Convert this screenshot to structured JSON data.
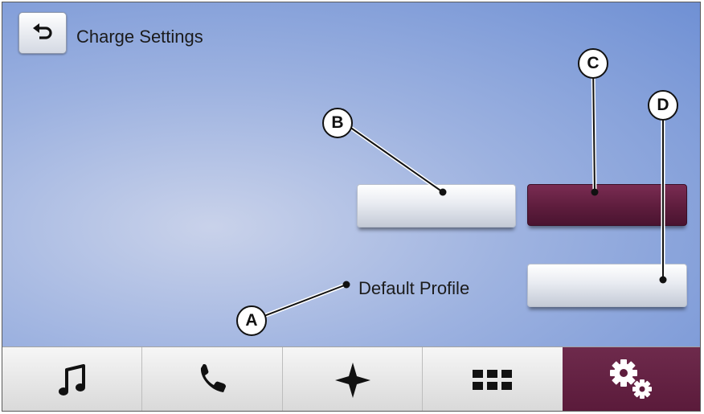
{
  "header": {
    "title": "Charge Settings",
    "back_icon": "back-arrow-icon"
  },
  "profile": {
    "label": "Default Profile"
  },
  "callouts": [
    "A",
    "B",
    "C",
    "D"
  ],
  "colors": {
    "accent": "#5e1d3d",
    "background": "#9db2e0",
    "nav_bar": "#e6e6e6"
  },
  "nav": {
    "items": [
      {
        "id": "audio",
        "icon": "music-note-icon",
        "active": false
      },
      {
        "id": "phone",
        "icon": "phone-icon",
        "active": false
      },
      {
        "id": "navigation",
        "icon": "navigation-star-icon",
        "active": false
      },
      {
        "id": "apps",
        "icon": "apps-grid-icon",
        "active": false
      },
      {
        "id": "settings",
        "icon": "settings-gears-icon",
        "active": true
      }
    ]
  }
}
